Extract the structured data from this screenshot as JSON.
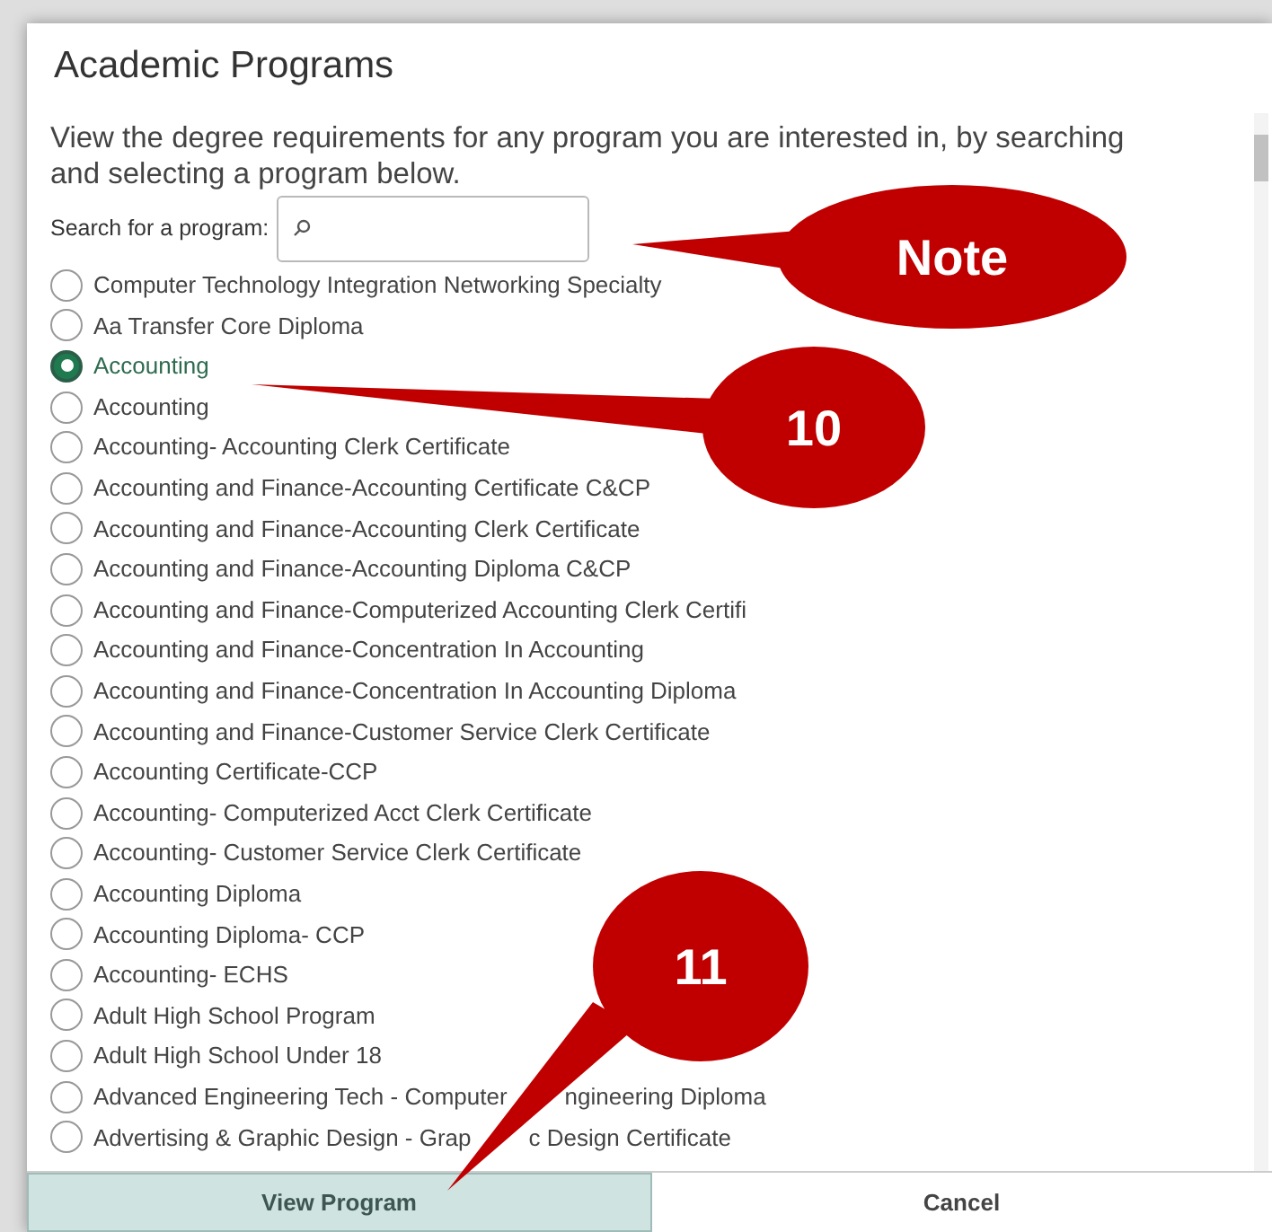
{
  "dialog": {
    "title": "Academic Programs",
    "description": "View the degree requirements for any program you are interested in, by searching and selecting a program below.",
    "search": {
      "label": "Search for a program:"
    },
    "programs": [
      {
        "name": "Computer Technology Integration Networking Specialty",
        "selected": false
      },
      {
        "name": "Aa Transfer Core Diploma",
        "selected": false
      },
      {
        "name": "Accounting",
        "selected": true
      },
      {
        "name": "Accounting",
        "selected": false
      },
      {
        "name": "Accounting- Accounting Clerk Certificate",
        "selected": false
      },
      {
        "name": "Accounting and Finance-Accounting Certificate C&CP",
        "selected": false
      },
      {
        "name": "Accounting and Finance-Accounting Clerk Certificate",
        "selected": false
      },
      {
        "name": "Accounting and Finance-Accounting Diploma C&CP",
        "selected": false
      },
      {
        "name": "Accounting and Finance-Computerized Accounting Clerk Certifi",
        "selected": false
      },
      {
        "name": "Accounting and Finance-Concentration In Accounting",
        "selected": false
      },
      {
        "name": "Accounting and Finance-Concentration In Accounting Diploma",
        "selected": false
      },
      {
        "name": "Accounting and Finance-Customer Service Clerk Certificate",
        "selected": false
      },
      {
        "name": "Accounting Certificate-CCP",
        "selected": false
      },
      {
        "name": "Accounting- Computerized Acct Clerk Certificate",
        "selected": false
      },
      {
        "name": "Accounting- Customer Service Clerk Certificate",
        "selected": false
      },
      {
        "name": "Accounting Diploma",
        "selected": false
      },
      {
        "name": "Accounting Diploma- CCP",
        "selected": false
      },
      {
        "name": "Accounting- ECHS",
        "selected": false
      },
      {
        "name": "Adult High School Program",
        "selected": false
      },
      {
        "name": "Adult High School Under 18",
        "selected": false
      },
      {
        "name": "Advanced Engineering Tech - Computer",
        "after_cover": "ngineering Diploma",
        "selected": false
      },
      {
        "name": "Advertising & Graphic Design - Grap",
        "after_cover": "c Design Certificate",
        "selected": false
      }
    ],
    "buttons": [
      {
        "label": "View Program",
        "kind": "primary"
      },
      {
        "label": "Cancel",
        "kind": "secondary"
      }
    ]
  },
  "callouts": [
    {
      "label": "Note"
    },
    {
      "label": "10"
    },
    {
      "label": "11"
    }
  ]
}
